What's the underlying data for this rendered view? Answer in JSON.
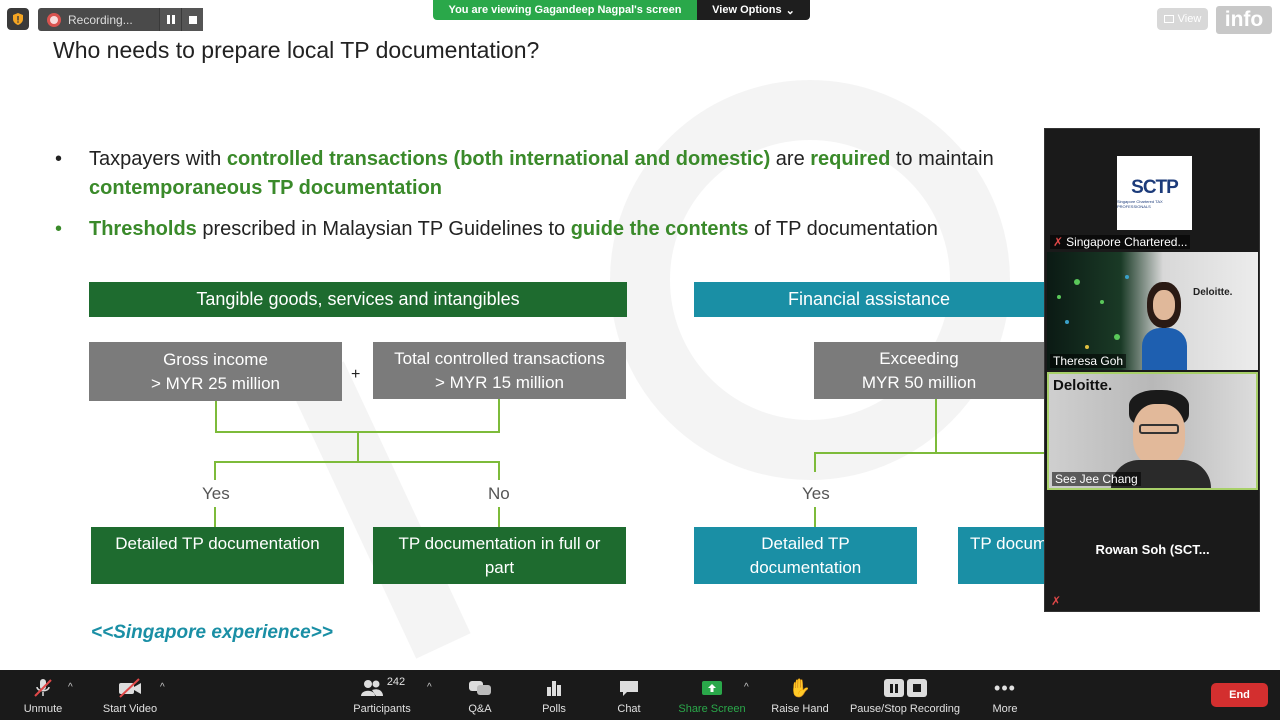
{
  "topbar": {
    "recording_label": "Recording...",
    "viewing_label": "You are viewing Gagandeep Nagpal's screen",
    "view_options_label": "View Options",
    "view_label": "View",
    "info_logo": "info"
  },
  "slide": {
    "title": "Who needs to prepare local TP documentation?",
    "bullet1": {
      "p1": "Taxpayers with ",
      "p2": "controlled transactions (both international and domestic)",
      "p3": " are ",
      "p4": "required",
      "p5": " to maintain",
      "line2": "contemporaneous TP documentation"
    },
    "bullet2": {
      "p1": "Thresholds",
      "p2": " prescribed in Malaysian TP Guidelines to ",
      "p3": "guide the contents",
      "p4": " of TP documentation"
    },
    "left_header": "Tangible goods, services and intangibles",
    "gross_income_l1": "Gross income",
    "gross_income_l2": "> MYR 25 million",
    "plus": "+",
    "total_ct_l1": "Total controlled transactions",
    "total_ct_l2": "> MYR 15 million",
    "yes_left": "Yes",
    "no_left": "No",
    "detailed_left": "Detailed TP documentation",
    "full_or_part_l1": "TP documentation in full or",
    "full_or_part_l2": "part",
    "right_header": "Financial assistance",
    "exceeding_l1": "Exceeding",
    "exceeding_l2": "MYR 50 million",
    "yes_right": "Yes",
    "detailed_right_l1": "Detailed TP",
    "detailed_right_l2": "documentation",
    "tp_docu_partial": "TP docum",
    "singapore_experience": "<<Singapore experience>>"
  },
  "participants_panel": {
    "tile1_name": "Singapore Chartered...",
    "tile1_logo": "SCTP",
    "tile1_logo_sub": "Singapore Chartered TAX PROFESSIONALS",
    "tile2_name": "Theresa Goh",
    "tile2_brand": "Deloitte.",
    "tile3_name": "See Jee Chang",
    "tile3_brand": "Deloitte.",
    "tile4_name": "Rowan Soh (SCT..."
  },
  "toolbar": {
    "unmute": "Unmute",
    "start_video": "Start Video",
    "participants": "Participants",
    "participants_count": "242",
    "qa": "Q&A",
    "polls": "Polls",
    "chat": "Chat",
    "share_screen": "Share Screen",
    "raise_hand": "Raise Hand",
    "pause_stop": "Pause/Stop Recording",
    "more": "More",
    "end": "End"
  },
  "colors": {
    "green_text": "#3a8a2a",
    "dark_green": "#1e6b2f",
    "teal": "#1a8fa5",
    "gray_box": "#7b7b7b",
    "share_green": "#2aa84a",
    "end_red": "#d32f2f"
  }
}
